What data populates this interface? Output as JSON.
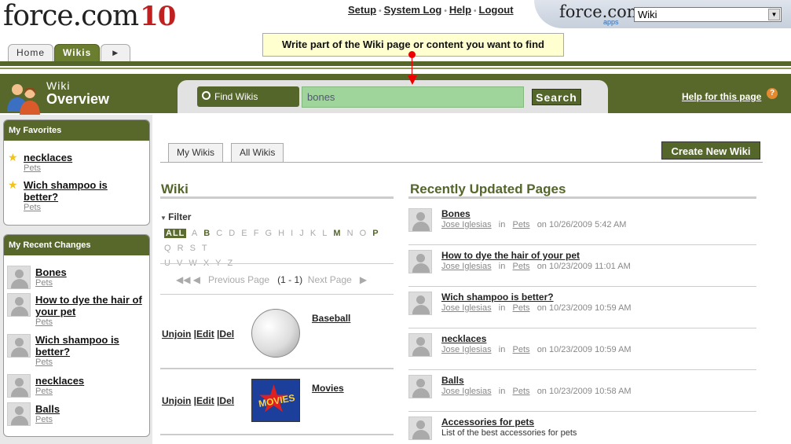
{
  "header": {
    "logo_text": "force.com",
    "logo_release": "10",
    "links": [
      "Setup",
      "System Log",
      "Help",
      "Logout"
    ],
    "apps_logo": "force.com",
    "apps_logo_sub": "apps",
    "app_selector_value": "Wiki",
    "tabs": [
      {
        "label": "Home",
        "active": false
      },
      {
        "label": "Wikis",
        "active": true
      }
    ]
  },
  "tooltip": "Write part of the Wiki page or content you want to find",
  "band": {
    "small_title": "Wiki",
    "title": "Overview",
    "find_label": "Find Wikis",
    "search_value": "bones",
    "search_button": "Search",
    "help_link": "Help for this page",
    "help_icon": "?"
  },
  "sidebar": {
    "favorites_title": "My Favorites",
    "favorites": [
      {
        "title": "necklaces",
        "sub": "Pets"
      },
      {
        "title": "Wich shampoo is better?",
        "sub": "Pets"
      }
    ],
    "recent_title": "My Recent Changes",
    "recent": [
      {
        "title": "Bones",
        "sub": "Pets"
      },
      {
        "title": "How to dye the hair of your pet",
        "sub": "Pets"
      },
      {
        "title": "Wich shampoo is better?",
        "sub": "Pets"
      },
      {
        "title": "necklaces",
        "sub": "Pets"
      },
      {
        "title": "Balls",
        "sub": "Pets"
      }
    ]
  },
  "main": {
    "subtabs": [
      "My Wikis",
      "All Wikis"
    ],
    "new_wiki_button": "Create New Wiki",
    "wiki_title": "Wiki",
    "filter_label": "Filter",
    "letters_row1": [
      "ALL",
      "A",
      "B",
      "C",
      "D",
      "E",
      "F",
      "G",
      "H",
      "I",
      "J",
      "K",
      "L",
      "M",
      "N",
      "O",
      "P",
      "Q",
      "R",
      "S",
      "T"
    ],
    "letters_row2": [
      "U",
      "V",
      "W",
      "X",
      "Y",
      "Z"
    ],
    "active_letters": [
      "B",
      "M",
      "P"
    ],
    "pager": {
      "prev": "Previous Page",
      "range": "(1 - 1)",
      "next": "Next Page"
    },
    "wikis": [
      {
        "name": "Baseball",
        "actions": [
          "Unjoin",
          "Edit",
          "Del"
        ]
      },
      {
        "name": "Movies",
        "actions": [
          "Unjoin",
          "Edit",
          "Del"
        ],
        "image_text": "MOVIES"
      }
    ],
    "recent_title": "Recently Updated Pages",
    "recent_pages": [
      {
        "title": "Bones",
        "user": "Jose Iglesias",
        "in": "in",
        "wiki": "Pets",
        "date": "on 10/26/2009 5:42 AM"
      },
      {
        "title": "How to dye the hair of your pet",
        "user": "Jose Iglesias",
        "in": "in",
        "wiki": "Pets",
        "date": "on 10/23/2009 11:01 AM"
      },
      {
        "title": "Wich shampoo is better?",
        "user": "Jose Iglesias",
        "in": "in",
        "wiki": "Pets",
        "date": "on 10/23/2009 10:59 AM"
      },
      {
        "title": "necklaces",
        "user": "Jose Iglesias",
        "in": "in",
        "wiki": "Pets",
        "date": "on 10/23/2009 10:59 AM"
      },
      {
        "title": "Balls",
        "user": "Jose Iglesias",
        "in": "in",
        "wiki": "Pets",
        "date": "on 10/23/2009 10:58 AM"
      },
      {
        "title": "Accessories for pets",
        "description": "List of the best accessories for pets"
      }
    ]
  },
  "colors": {
    "brand_green": "#55662a",
    "search_green": "#9fd49a",
    "tooltip_bg": "#ffffd0",
    "pointer_red": "#e00000"
  }
}
